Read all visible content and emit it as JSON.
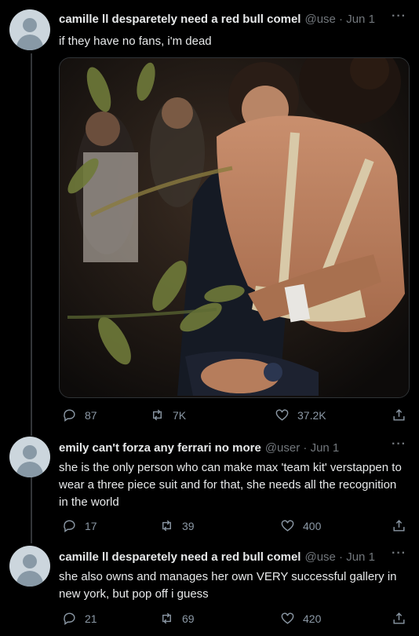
{
  "tweets": [
    {
      "display_name": "camille ll desparetely need a red bull comel",
      "handle_date": "@use · Jun 1",
      "text": "if they have no fans, i'm dead",
      "replies": "87",
      "retweets": "7K",
      "likes": "37.2K"
    },
    {
      "display_name": "emily can't forza any ferrari no more",
      "handle_date": "@user · Jun 1",
      "text": "she is the only person who can make max 'team kit' verstappen to wear a three piece suit and for that, she needs all the recognition in the world",
      "replies": "17",
      "retweets": "39",
      "likes": "400"
    },
    {
      "display_name": "camille ll desparetely need a red bull comel",
      "handle_date": "@use · Jun 1",
      "text": "she also owns and manages her own VERY successful gallery in new york, but pop off i guess",
      "replies": "21",
      "retweets": "69",
      "likes": "420"
    }
  ],
  "more_glyph": "···",
  "colors": {
    "background": "#000000",
    "text": "#e7e9ea",
    "muted": "#71767b",
    "thread_line": "#333639"
  },
  "icons": [
    "reply-icon",
    "retweet-icon",
    "like-icon",
    "share-icon",
    "more-icon",
    "default-avatar"
  ]
}
